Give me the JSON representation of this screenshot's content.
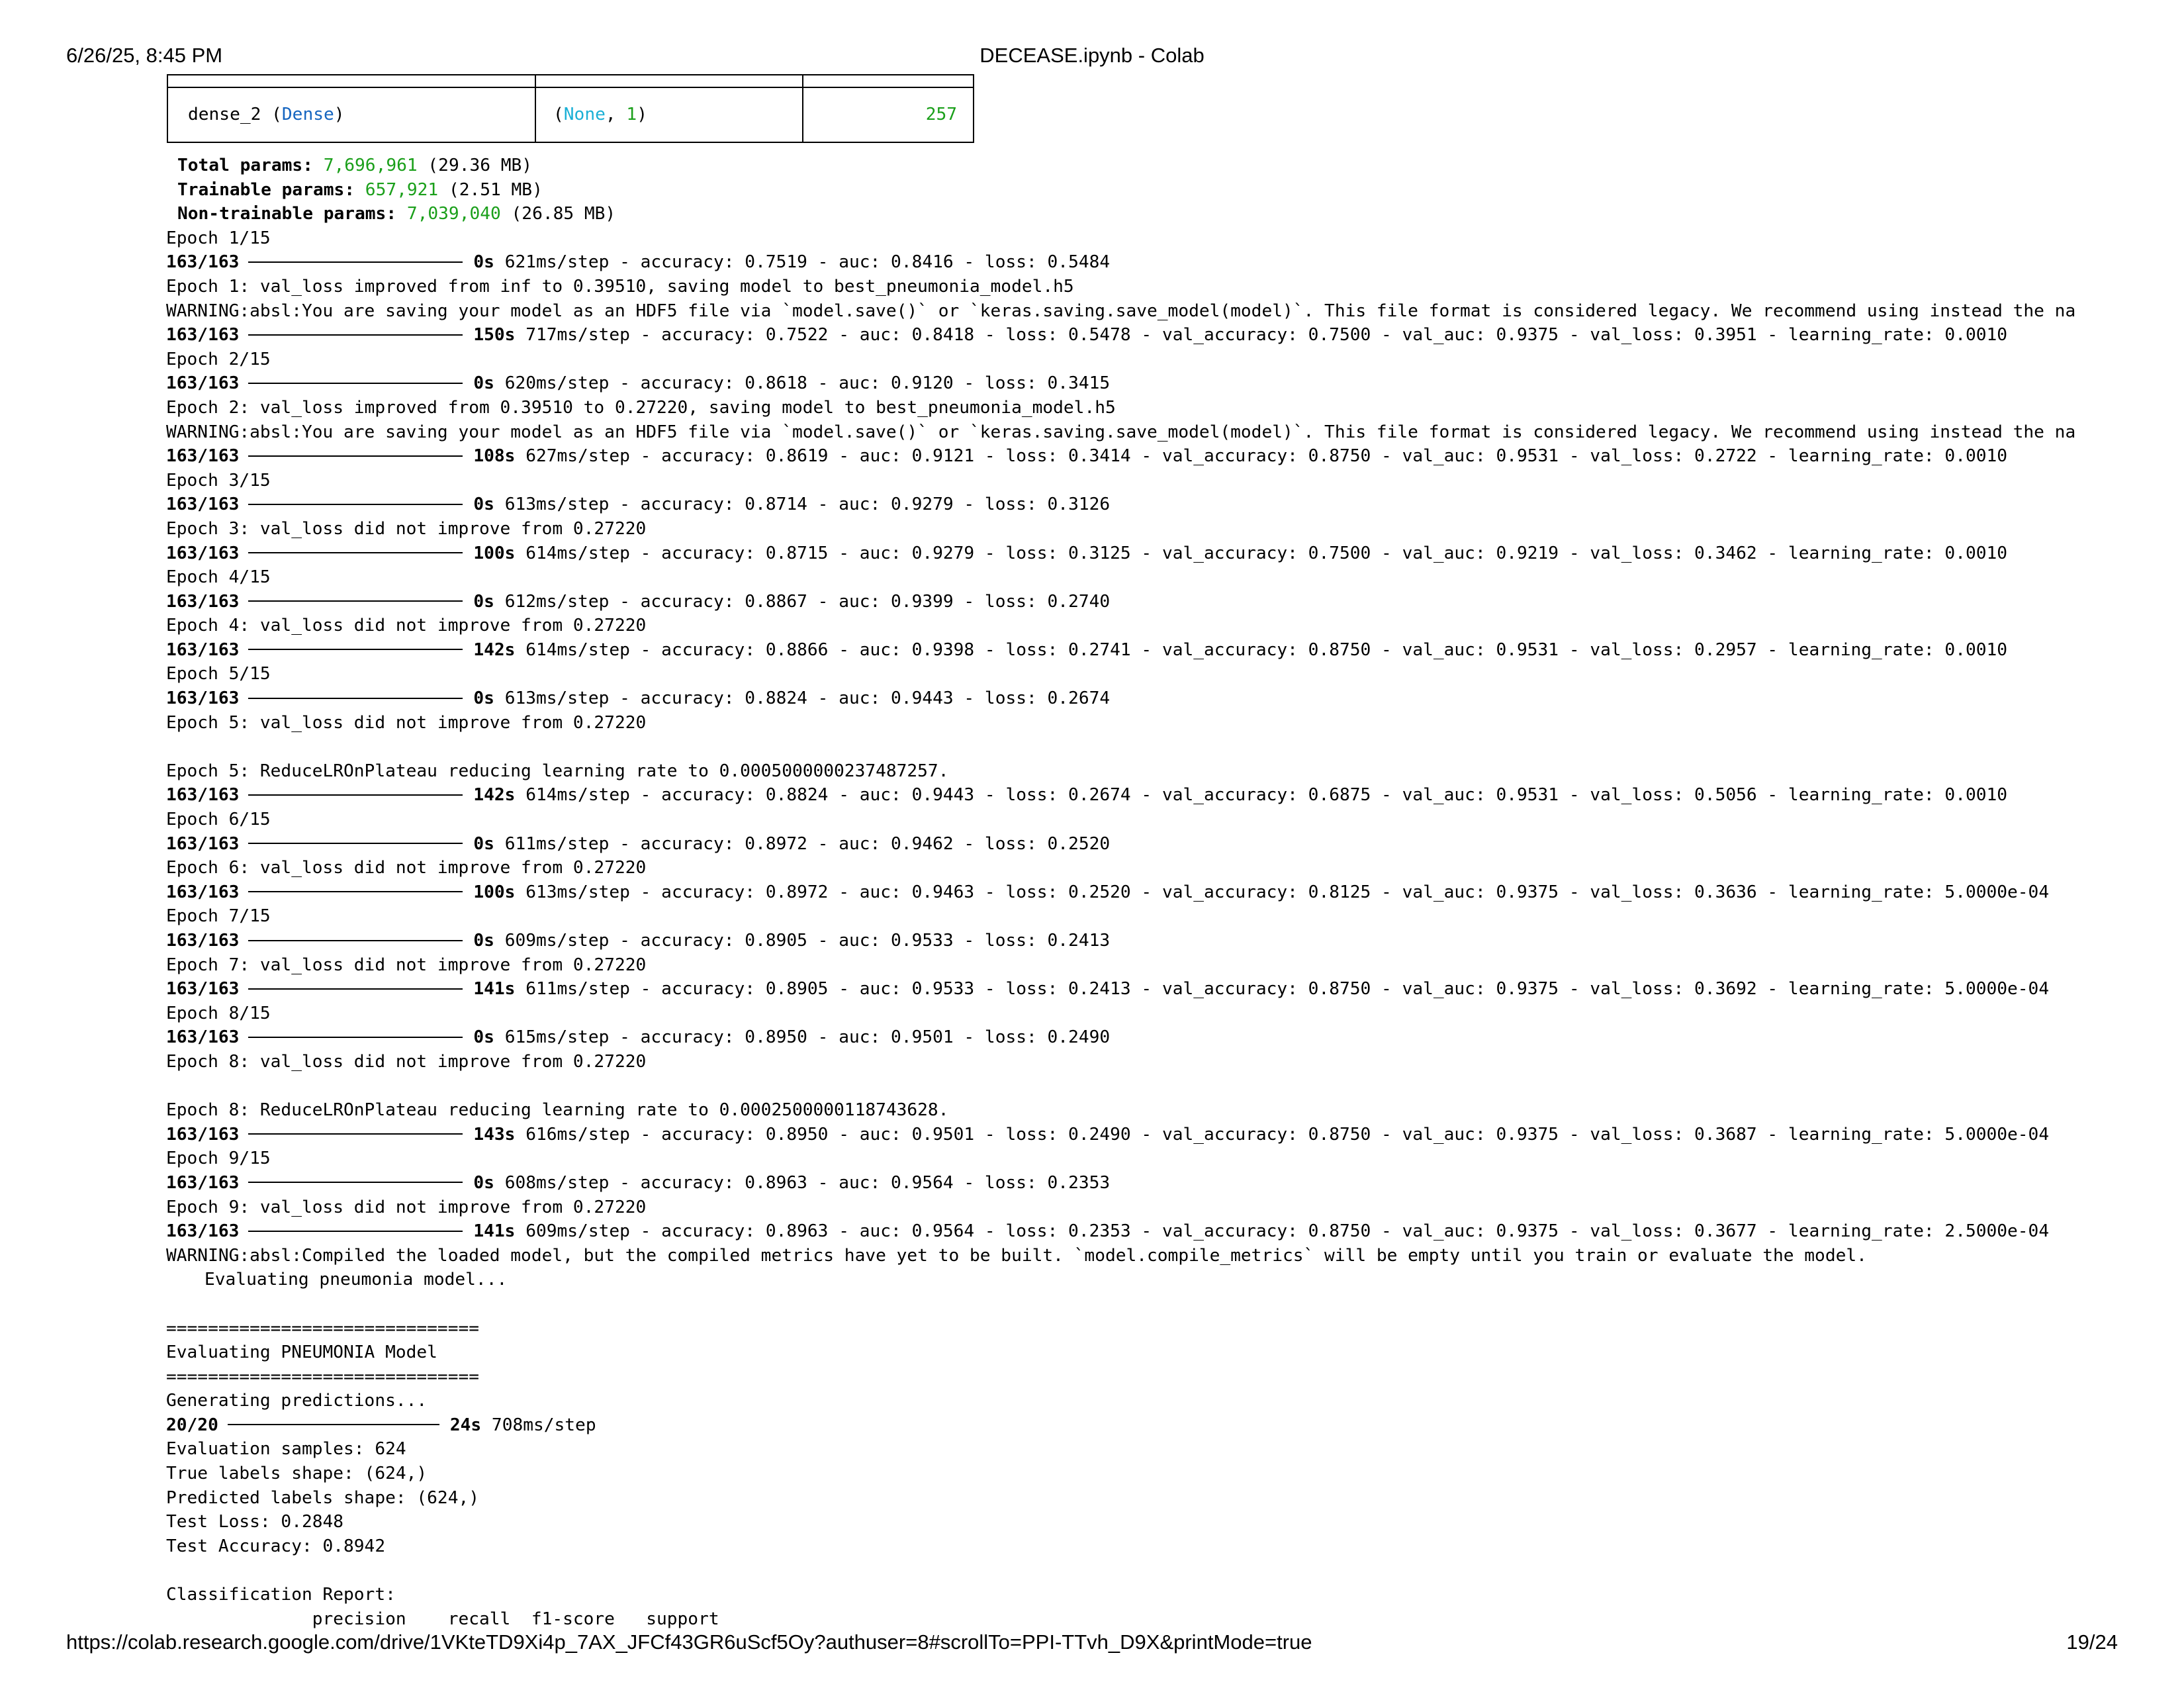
{
  "header": {
    "datetime": "6/26/25, 8:45 PM",
    "title": "DECEASE.ipynb - Colab"
  },
  "footer": {
    "url": "https://colab.research.google.com/drive/1VKteTD9Xi4p_7AX_JFCf43GR6uScf5Oy?authuser=8#scrollTo=PPI-TTvh_D9X&printMode=true",
    "page": "19/24"
  },
  "summary": {
    "layer_name": "dense_2 (",
    "layer_type": "Dense",
    "layer_close": ")",
    "shape_open": "(",
    "shape_none": "None",
    "shape_sep": ", ",
    "shape_one": "1",
    "shape_close": ")",
    "params": "257",
    "total_label": "Total params: ",
    "total_value": "7,696,961",
    "total_size": " (29.36 MB)",
    "trainable_label": "Trainable params: ",
    "trainable_value": "657,921",
    "trainable_size": " (2.51 MB)",
    "nontrainable_label": "Non-trainable params: ",
    "nontrainable_value": "7,039,040",
    "nontrainable_size": " (26.85 MB)"
  },
  "log": [
    {
      "kind": "text",
      "text": "Epoch 1/15"
    },
    {
      "kind": "prog",
      "step": "163/163",
      "time": "0s",
      "rest": " 621ms/step - accuracy: 0.7519 - auc: 0.8416 - loss: 0.5484"
    },
    {
      "kind": "text",
      "text": "Epoch 1: val_loss improved from inf to 0.39510, saving model to best_pneumonia_model.h5"
    },
    {
      "kind": "text",
      "text": "WARNING:absl:You are saving your model as an HDF5 file via `model.save()` or `keras.saving.save_model(model)`. This file format is considered legacy. We recommend using instead the na"
    },
    {
      "kind": "prog",
      "step": "163/163",
      "time": "150s",
      "rest": " 717ms/step - accuracy: 0.7522 - auc: 0.8418 - loss: 0.5478 - val_accuracy: 0.7500 - val_auc: 0.9375 - val_loss: 0.3951 - learning_rate: 0.0010"
    },
    {
      "kind": "text",
      "text": "Epoch 2/15"
    },
    {
      "kind": "prog",
      "step": "163/163",
      "time": "0s",
      "rest": " 620ms/step - accuracy: 0.8618 - auc: 0.9120 - loss: 0.3415"
    },
    {
      "kind": "text",
      "text": "Epoch 2: val_loss improved from 0.39510 to 0.27220, saving model to best_pneumonia_model.h5"
    },
    {
      "kind": "text",
      "text": "WARNING:absl:You are saving your model as an HDF5 file via `model.save()` or `keras.saving.save_model(model)`. This file format is considered legacy. We recommend using instead the na"
    },
    {
      "kind": "prog",
      "step": "163/163",
      "time": "108s",
      "rest": " 627ms/step - accuracy: 0.8619 - auc: 0.9121 - loss: 0.3414 - val_accuracy: 0.8750 - val_auc: 0.9531 - val_loss: 0.2722 - learning_rate: 0.0010"
    },
    {
      "kind": "text",
      "text": "Epoch 3/15"
    },
    {
      "kind": "prog",
      "step": "163/163",
      "time": "0s",
      "rest": " 613ms/step - accuracy: 0.8714 - auc: 0.9279 - loss: 0.3126"
    },
    {
      "kind": "text",
      "text": "Epoch 3: val_loss did not improve from 0.27220"
    },
    {
      "kind": "prog",
      "step": "163/163",
      "time": "100s",
      "rest": " 614ms/step - accuracy: 0.8715 - auc: 0.9279 - loss: 0.3125 - val_accuracy: 0.7500 - val_auc: 0.9219 - val_loss: 0.3462 - learning_rate: 0.0010"
    },
    {
      "kind": "text",
      "text": "Epoch 4/15"
    },
    {
      "kind": "prog",
      "step": "163/163",
      "time": "0s",
      "rest": " 612ms/step - accuracy: 0.8867 - auc: 0.9399 - loss: 0.2740"
    },
    {
      "kind": "text",
      "text": "Epoch 4: val_loss did not improve from 0.27220"
    },
    {
      "kind": "prog",
      "step": "163/163",
      "time": "142s",
      "rest": " 614ms/step - accuracy: 0.8866 - auc: 0.9398 - loss: 0.2741 - val_accuracy: 0.8750 - val_auc: 0.9531 - val_loss: 0.2957 - learning_rate: 0.0010"
    },
    {
      "kind": "text",
      "text": "Epoch 5/15"
    },
    {
      "kind": "prog",
      "step": "163/163",
      "time": "0s",
      "rest": " 613ms/step - accuracy: 0.8824 - auc: 0.9443 - loss: 0.2674"
    },
    {
      "kind": "text",
      "text": "Epoch 5: val_loss did not improve from 0.27220"
    },
    {
      "kind": "text",
      "text": ""
    },
    {
      "kind": "text",
      "text": "Epoch 5: ReduceLROnPlateau reducing learning rate to 0.0005000000237487257."
    },
    {
      "kind": "prog",
      "step": "163/163",
      "time": "142s",
      "rest": " 614ms/step - accuracy: 0.8824 - auc: 0.9443 - loss: 0.2674 - val_accuracy: 0.6875 - val_auc: 0.9531 - val_loss: 0.5056 - learning_rate: 0.0010"
    },
    {
      "kind": "text",
      "text": "Epoch 6/15"
    },
    {
      "kind": "prog",
      "step": "163/163",
      "time": "0s",
      "rest": " 611ms/step - accuracy: 0.8972 - auc: 0.9462 - loss: 0.2520"
    },
    {
      "kind": "text",
      "text": "Epoch 6: val_loss did not improve from 0.27220"
    },
    {
      "kind": "prog",
      "step": "163/163",
      "time": "100s",
      "rest": " 613ms/step - accuracy: 0.8972 - auc: 0.9463 - loss: 0.2520 - val_accuracy: 0.8125 - val_auc: 0.9375 - val_loss: 0.3636 - learning_rate: 5.0000e-04"
    },
    {
      "kind": "text",
      "text": "Epoch 7/15"
    },
    {
      "kind": "prog",
      "step": "163/163",
      "time": "0s",
      "rest": " 609ms/step - accuracy: 0.8905 - auc: 0.9533 - loss: 0.2413"
    },
    {
      "kind": "text",
      "text": "Epoch 7: val_loss did not improve from 0.27220"
    },
    {
      "kind": "prog",
      "step": "163/163",
      "time": "141s",
      "rest": " 611ms/step - accuracy: 0.8905 - auc: 0.9533 - loss: 0.2413 - val_accuracy: 0.8750 - val_auc: 0.9375 - val_loss: 0.3692 - learning_rate: 5.0000e-04"
    },
    {
      "kind": "text",
      "text": "Epoch 8/15"
    },
    {
      "kind": "prog",
      "step": "163/163",
      "time": "0s",
      "rest": " 615ms/step - accuracy: 0.8950 - auc: 0.9501 - loss: 0.2490"
    },
    {
      "kind": "text",
      "text": "Epoch 8: val_loss did not improve from 0.27220"
    },
    {
      "kind": "text",
      "text": ""
    },
    {
      "kind": "text",
      "text": "Epoch 8: ReduceLROnPlateau reducing learning rate to 0.0002500000118743628."
    },
    {
      "kind": "prog",
      "step": "163/163",
      "time": "143s",
      "rest": " 616ms/step - accuracy: 0.8950 - auc: 0.9501 - loss: 0.2490 - val_accuracy: 0.8750 - val_auc: 0.9375 - val_loss: 0.3687 - learning_rate: 5.0000e-04"
    },
    {
      "kind": "text",
      "text": "Epoch 9/15"
    },
    {
      "kind": "prog",
      "step": "163/163",
      "time": "0s",
      "rest": " 608ms/step - accuracy: 0.8963 - auc: 0.9564 - loss: 0.2353"
    },
    {
      "kind": "text",
      "text": "Epoch 9: val_loss did not improve from 0.27220"
    },
    {
      "kind": "prog",
      "step": "163/163",
      "time": "141s",
      "rest": " 609ms/step - accuracy: 0.8963 - auc: 0.9564 - loss: 0.2353 - val_accuracy: 0.8750 - val_auc: 0.9375 - val_loss: 0.3677 - learning_rate: 2.5000e-04"
    },
    {
      "kind": "text",
      "text": "WARNING:absl:Compiled the loaded model, but the compiled metrics have yet to be built. `model.compile_metrics` will be empty until you train or evaluate the model."
    },
    {
      "kind": "indent",
      "text": "Evaluating pneumonia model..."
    },
    {
      "kind": "text",
      "text": ""
    },
    {
      "kind": "text",
      "text": "=============================="
    },
    {
      "kind": "text",
      "text": "Evaluating PNEUMONIA Model"
    },
    {
      "kind": "text",
      "text": "=============================="
    },
    {
      "kind": "text",
      "text": "Generating predictions..."
    },
    {
      "kind": "prog",
      "step": "20/20",
      "time": "24s",
      "rest": " 708ms/step"
    },
    {
      "kind": "text",
      "text": "Evaluation samples: 624"
    },
    {
      "kind": "text",
      "text": "True labels shape: (624,)"
    },
    {
      "kind": "text",
      "text": "Predicted labels shape: (624,)"
    },
    {
      "kind": "text",
      "text": "Test Loss: 0.2848"
    },
    {
      "kind": "text",
      "text": "Test Accuracy: 0.8942"
    },
    {
      "kind": "text",
      "text": ""
    },
    {
      "kind": "text",
      "text": "Classification Report:"
    },
    {
      "kind": "text",
      "text": "              precision    recall  f1-score   support"
    }
  ]
}
